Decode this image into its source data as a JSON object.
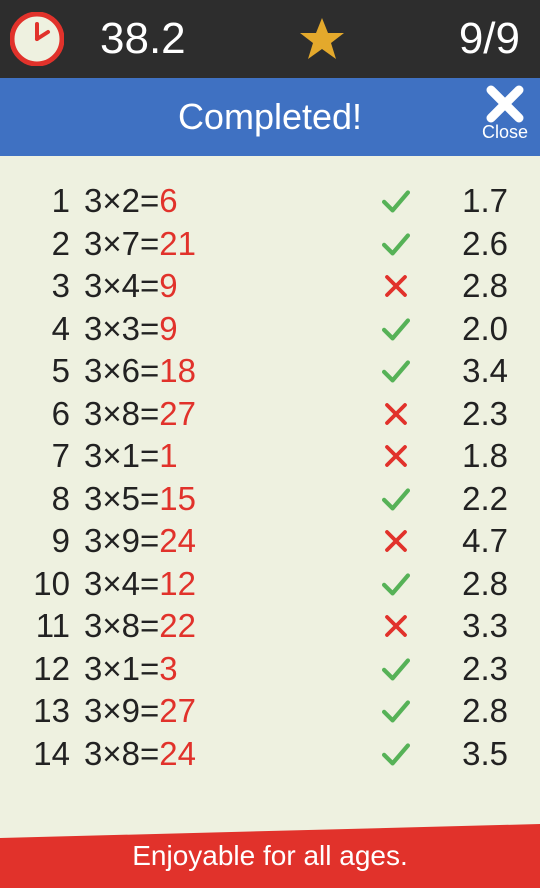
{
  "topbar": {
    "time": "38.2",
    "score": "9/9"
  },
  "header": {
    "title": "Completed!",
    "close_label": "Close"
  },
  "results": [
    {
      "n": "1",
      "a": "3",
      "op": "×",
      "b": "2",
      "ans": "6",
      "correct": true,
      "t": "1.7"
    },
    {
      "n": "2",
      "a": "3",
      "op": "×",
      "b": "7",
      "ans": "21",
      "correct": true,
      "t": "2.6"
    },
    {
      "n": "3",
      "a": "3",
      "op": "×",
      "b": "4",
      "ans": "9",
      "correct": false,
      "t": "2.8"
    },
    {
      "n": "4",
      "a": "3",
      "op": "×",
      "b": "3",
      "ans": "9",
      "correct": true,
      "t": "2.0"
    },
    {
      "n": "5",
      "a": "3",
      "op": "×",
      "b": "6",
      "ans": "18",
      "correct": true,
      "t": "3.4"
    },
    {
      "n": "6",
      "a": "3",
      "op": "×",
      "b": "8",
      "ans": "27",
      "correct": false,
      "t": "2.3"
    },
    {
      "n": "7",
      "a": "3",
      "op": "×",
      "b": "1",
      "ans": "1",
      "correct": false,
      "t": "1.8"
    },
    {
      "n": "8",
      "a": "3",
      "op": "×",
      "b": "5",
      "ans": "15",
      "correct": true,
      "t": "2.2"
    },
    {
      "n": "9",
      "a": "3",
      "op": "×",
      "b": "9",
      "ans": "24",
      "correct": false,
      "t": "4.7"
    },
    {
      "n": "10",
      "a": "3",
      "op": "×",
      "b": "4",
      "ans": "12",
      "correct": true,
      "t": "2.8"
    },
    {
      "n": "11",
      "a": "3",
      "op": "×",
      "b": "8",
      "ans": "22",
      "correct": false,
      "t": "3.3"
    },
    {
      "n": "12",
      "a": "3",
      "op": "×",
      "b": "1",
      "ans": "3",
      "correct": true,
      "t": "2.3"
    },
    {
      "n": "13",
      "a": "3",
      "op": "×",
      "b": "9",
      "ans": "27",
      "correct": true,
      "t": "2.8"
    },
    {
      "n": "14",
      "a": "3",
      "op": "×",
      "b": "8",
      "ans": "24",
      "correct": true,
      "t": "3.5"
    }
  ],
  "footer": {
    "message": "Enjoyable for all ages."
  },
  "colors": {
    "correct": "#56b257",
    "wrong": "#e1322b"
  }
}
